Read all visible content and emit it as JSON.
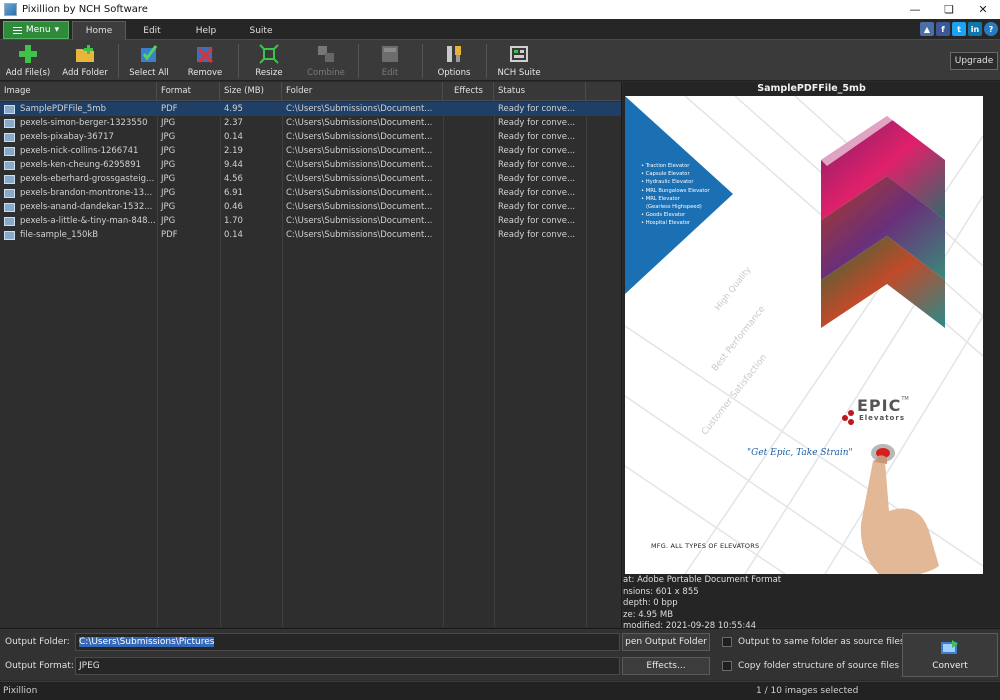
{
  "window": {
    "title": "Pixillion by NCH Software"
  },
  "ribbon": {
    "menu_label": "Menu",
    "tabs": [
      "Home",
      "Edit",
      "Help",
      "Suite"
    ],
    "social": {
      "like": "▲",
      "facebook": "f",
      "twitter": "t",
      "linkedin": "in",
      "help": "?"
    }
  },
  "toolbar": {
    "add_files": "Add File(s)",
    "add_folder": "Add Folder",
    "select_all": "Select All",
    "remove": "Remove",
    "resize": "Resize",
    "combine": "Combine",
    "edit": "Edit",
    "options": "Options",
    "nch_suite": "NCH Suite",
    "upgrade": "Upgrade"
  },
  "table": {
    "columns": [
      "Image",
      "Format",
      "Size (MB)",
      "Folder",
      "Effects",
      "Status"
    ],
    "rows": [
      {
        "name": "SamplePDFFile_5mb",
        "format": "PDF",
        "size": "4.95",
        "folder": "C:\\Users\\Submissions\\Document...",
        "effects": "",
        "status": "Ready for conve..."
      },
      {
        "name": "pexels-simon-berger-1323550",
        "format": "JPG",
        "size": "2.37",
        "folder": "C:\\Users\\Submissions\\Document...",
        "effects": "",
        "status": "Ready for conve..."
      },
      {
        "name": "pexels-pixabay-36717",
        "format": "JPG",
        "size": "0.14",
        "folder": "C:\\Users\\Submissions\\Document...",
        "effects": "",
        "status": "Ready for conve..."
      },
      {
        "name": "pexels-nick-collins-1266741",
        "format": "JPG",
        "size": "2.19",
        "folder": "C:\\Users\\Submissions\\Document...",
        "effects": "",
        "status": "Ready for conve..."
      },
      {
        "name": "pexels-ken-cheung-6295891",
        "format": "JPG",
        "size": "9.44",
        "folder": "C:\\Users\\Submissions\\Document...",
        "effects": "",
        "status": "Ready for conve..."
      },
      {
        "name": "pexels-eberhard-grossgasteig...",
        "format": "JPG",
        "size": "4.56",
        "folder": "C:\\Users\\Submissions\\Document...",
        "effects": "",
        "status": "Ready for conve..."
      },
      {
        "name": "pexels-brandon-montrone-13...",
        "format": "JPG",
        "size": "6.91",
        "folder": "C:\\Users\\Submissions\\Document...",
        "effects": "",
        "status": "Ready for conve..."
      },
      {
        "name": "pexels-anand-dandekar-1532...",
        "format": "JPG",
        "size": "0.46",
        "folder": "C:\\Users\\Submissions\\Document...",
        "effects": "",
        "status": "Ready for conve..."
      },
      {
        "name": "pexels-a-little-&-tiny-man-848...",
        "format": "JPG",
        "size": "1.70",
        "folder": "C:\\Users\\Submissions\\Document...",
        "effects": "",
        "status": "Ready for conve..."
      },
      {
        "name": "file-sample_150kB",
        "format": "PDF",
        "size": "0.14",
        "folder": "C:\\Users\\Submissions\\Document...",
        "effects": "",
        "status": "Ready for conve..."
      }
    ]
  },
  "preview": {
    "title": "SamplePDFFile_5mb",
    "doc": {
      "bullets": [
        "Traction Elevator",
        "Capsule Elevator",
        "Hydraulic Elevator",
        "MRL Bungalows Elevator",
        "MRL Elevator",
        "(Gearless Highspeed)",
        "Goods Elevator",
        "Hospital Elevator"
      ],
      "diag_1": "High Quality",
      "diag_2": "Best Performance",
      "diag_3": "Customer Satisfaction",
      "brand": "EPIC",
      "brand_tm": "TM",
      "brand_sub": "Elevators",
      "tagline": "\"Get Epic, Take Strain\"",
      "footer": "MFG. ALL TYPES OF ELEVATORS"
    },
    "info": [
      "at: Adobe Portable Document Format",
      "nsions: 601 x 855",
      " depth: 0 bpp",
      "ze: 4.95 MB",
      "modified: 2021-09-28 10:55:44"
    ]
  },
  "output": {
    "folder_label": "Output Folder:",
    "folder_value": "C:\\Users\\Submissions\\Pictures",
    "format_label": "Output Format:",
    "format_value": "JPEG",
    "open_folder": "pen Output Folder",
    "effects": "Effects...",
    "same_folder": "Output to same folder as source files",
    "copy_structure": "Copy folder structure of source files",
    "convert": "Convert"
  },
  "statusbar": {
    "app": "Pixillion",
    "selection": "1 / 10 images selected"
  },
  "colors": {
    "accent_green": "#2f8a3c",
    "selection_blue": "#1f3f66",
    "epic_red": "#c0161e",
    "doc_blue": "#1b6fb3"
  }
}
